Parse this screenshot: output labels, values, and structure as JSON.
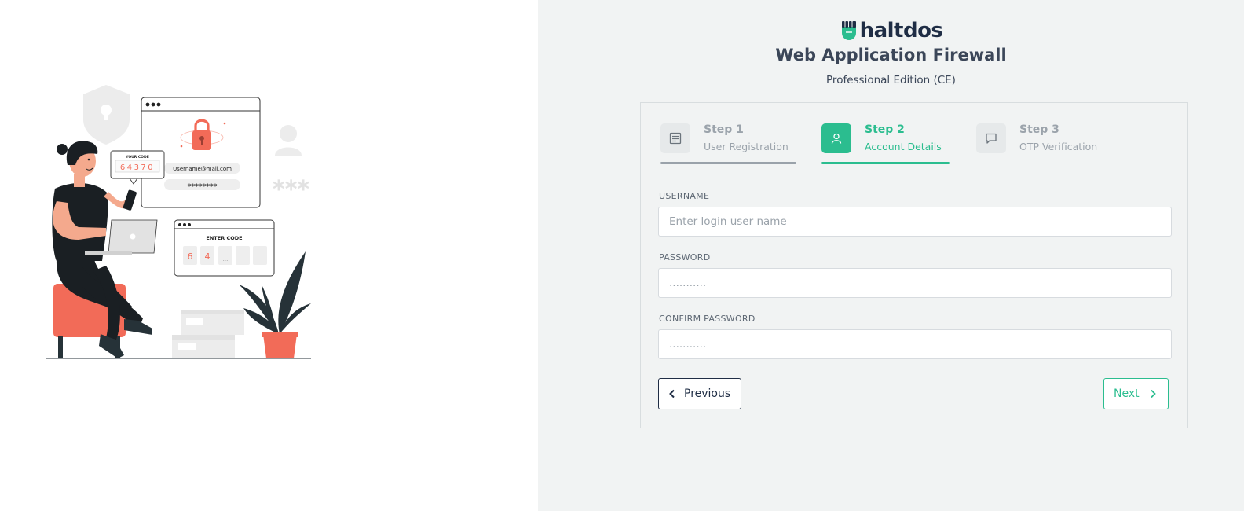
{
  "brand": {
    "logo_text": "haltdos",
    "title": "Web Application Firewall",
    "subtitle": "Professional Edition (CE)",
    "accent_color": "#2bbd8f",
    "dark_color": "#1f2d45"
  },
  "illustration": {
    "code_label": "YOUR CODE",
    "code_value": "64370",
    "email_text": "Username@mail.com",
    "password_mask": "********",
    "enter_code_label": "ENTER CODE",
    "digits": [
      "6",
      "4",
      "..."
    ],
    "stars": "***"
  },
  "steps": [
    {
      "title": "Step 1",
      "subtitle": "User Registration",
      "icon": "document-icon",
      "state": "completed"
    },
    {
      "title": "Step 2",
      "subtitle": "Account Details",
      "icon": "user-icon",
      "state": "active"
    },
    {
      "title": "Step 3",
      "subtitle": "OTP Verification",
      "icon": "chat-icon",
      "state": "pending"
    }
  ],
  "form": {
    "username_label": "USERNAME",
    "username_placeholder": "Enter login user name",
    "password_label": "PASSWORD",
    "password_placeholder": "...........",
    "confirm_label": "CONFIRM PASSWORD",
    "confirm_placeholder": "..........."
  },
  "buttons": {
    "previous": "Previous",
    "next": "Next"
  }
}
